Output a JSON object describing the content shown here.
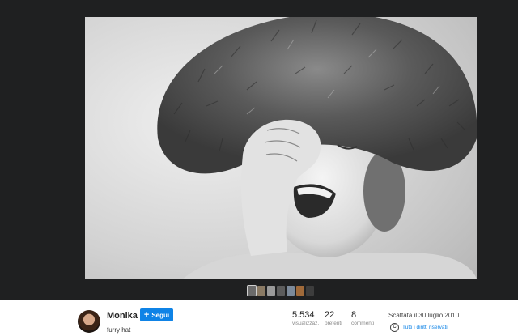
{
  "photo": {
    "subject_icon": "photo-laughing-child-fur-hat"
  },
  "filmstrip": {
    "thumbnails": [
      {
        "color": "#6b6b6b",
        "active": true
      },
      {
        "color": "#8a7a64"
      },
      {
        "color": "#9a9a9a"
      },
      {
        "color": "#5c5c5c"
      },
      {
        "color": "#7c8a9a"
      },
      {
        "color": "#a06a3a"
      },
      {
        "color": "#3d3d3d"
      }
    ]
  },
  "info": {
    "author": "Monika",
    "follow_label": "Segui",
    "follow_icon": "plus-icon",
    "photo_title": "furry hat",
    "stats": {
      "views": {
        "value": "5.534",
        "label": "visualizzaz."
      },
      "favorites": {
        "value": "22",
        "label": "preferiti"
      },
      "comments": {
        "value": "8",
        "label": "commenti"
      }
    },
    "taken": "Scattata il 30 luglio 2010",
    "rights": "Tutti i diritti riservati",
    "rights_icon": "copyright-icon"
  },
  "colors": {
    "background": "#1f2021",
    "accent": "#0f83e6",
    "info_bar": "#ffffff"
  }
}
